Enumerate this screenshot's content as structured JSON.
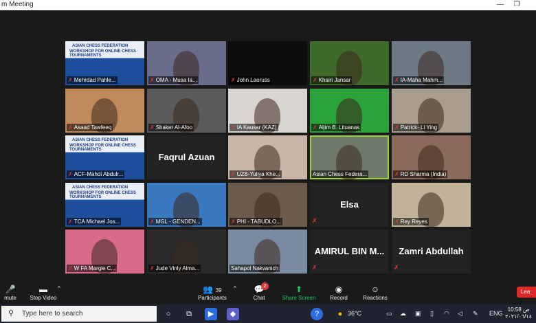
{
  "window": {
    "title": "m Meeting"
  },
  "tiles": [
    {
      "label": "Mehrdad Pahle...",
      "muted": true,
      "banner": true
    },
    {
      "label": "OMA - Musa Ia...",
      "muted": true
    },
    {
      "label": "John Laoruss",
      "muted": true
    },
    {
      "label": "Khairi Jansar",
      "muted": true
    },
    {
      "label": "IA-Maha Mahm...",
      "muted": true
    },
    {
      "label": "Asaad Tawfeeq",
      "muted": true
    },
    {
      "label": "Shaker Al-Afoo",
      "muted": true
    },
    {
      "label": "IA Kausar (KAZ)",
      "muted": true
    },
    {
      "label": "Aljim B. Lituanas",
      "muted": true
    },
    {
      "label": "Patrick- Li Ying",
      "muted": true
    },
    {
      "label": "ACF-Mahdi Abdulr...",
      "muted": true,
      "banner": true
    },
    {
      "label": "",
      "bigname": "Faqrul Azuan",
      "muted": false
    },
    {
      "label": "UZB-Yuliya Khe...",
      "muted": true
    },
    {
      "label": "Asian Chess Federa...",
      "muted": false,
      "active": true
    },
    {
      "label": "RD Sharma (India)",
      "muted": true
    },
    {
      "label": "TCA Michael Jos...",
      "muted": true,
      "banner": true
    },
    {
      "label": "MGL - GENDEN...",
      "muted": true
    },
    {
      "label": "PHI - TABUDLO...",
      "muted": true
    },
    {
      "label": "",
      "bigname": "Elsa",
      "muted": true
    },
    {
      "label": "Rey Reyes",
      "muted": true
    },
    {
      "label": "W FA Margie C...",
      "muted": true
    },
    {
      "label": "Jude Vinly Alma...",
      "muted": true
    },
    {
      "label": "Sahapol Nakvanich",
      "muted": false
    },
    {
      "label": "",
      "bigname": "AMIRUL BIN M...",
      "muted": true
    },
    {
      "label": "",
      "bigname": "Zamri Abdullah",
      "muted": true
    }
  ],
  "banner": {
    "line1": "ASIAN CHESS FEDERATION",
    "line2": "WORKSHOP FOR ONLINE CHESS TOURNAMENTS"
  },
  "toolbar": {
    "mute": "mute",
    "stop_video": "Stop Video",
    "participants": "Participants",
    "participants_count": "39",
    "chat": "Chat",
    "chat_badge": "2",
    "share": "Share Screen",
    "record": "Record",
    "reactions": "Reactions",
    "leave": "Lea"
  },
  "taskbar": {
    "search_placeholder": "Type here to search",
    "temperature": "36°C",
    "language": "ENG",
    "time": "10:58 ص",
    "date": "٢٠٢١/٠٦/١٤"
  },
  "colors": {
    "accent_green": "#9bd12d",
    "share_green": "#23c45e",
    "leave_red": "#e02828"
  }
}
